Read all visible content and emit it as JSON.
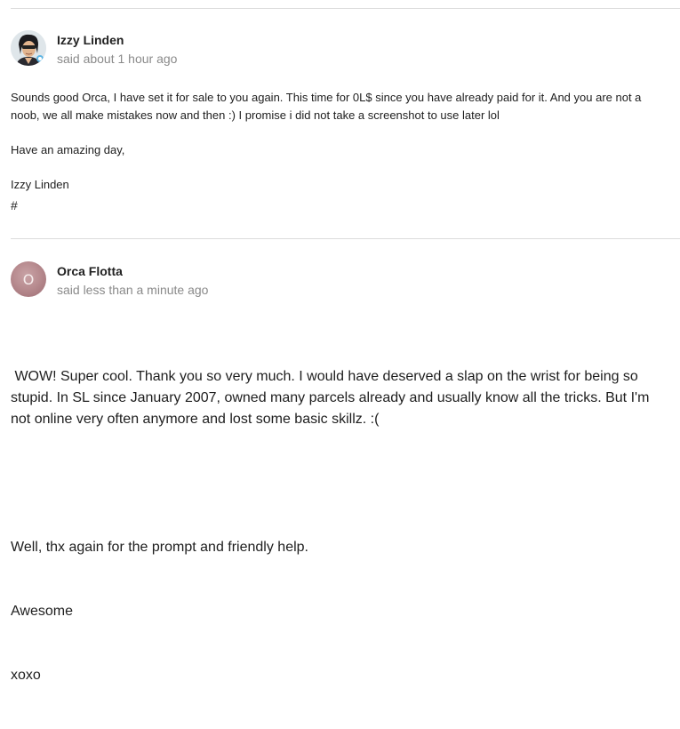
{
  "posts": [
    {
      "author": "Izzy Linden",
      "meta": "said about 1 hour ago",
      "avatar_icon": "user-photo-avatar",
      "paragraphs": [
        "Sounds good Orca, I have set it for sale to you again. This time for 0L$ since you have already paid for it. And you are not a noob, we all make mistakes now and then :) I promise i did not take a screenshot to use later lol",
        "Have an amazing day,",
        "Izzy Linden"
      ],
      "hash": "#"
    },
    {
      "author": "Orca Flotta",
      "meta": "said less than a minute ago",
      "avatar_initial": "O",
      "paragraphs": [
        " WOW! Super cool. Thank you so very much. I would have deserved a slap on the wrist for being so stupid. In SL since January 2007, owned many parcels already and usually know all the tricks. But I'm not online very often anymore and lost some basic skillz. :(",
        "Well, thx again for the prompt and friendly help.",
        "Awesome",
        "xoxo"
      ]
    }
  ]
}
